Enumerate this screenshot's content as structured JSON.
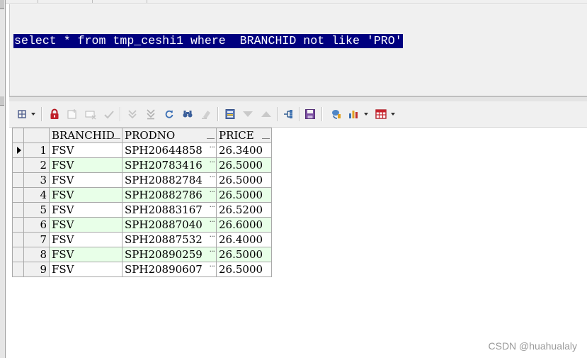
{
  "editor": {
    "sql": "select * from tmp_ceshi1 where  BRANCHID not like 'PRO'"
  },
  "toolbar": {
    "icons": [
      "select-grid-icon",
      "lock-icon",
      "add-row-icon",
      "delete-row-icon",
      "post-changes-icon",
      "first-record-icon",
      "last-record-icon",
      "refresh-icon",
      "find-icon",
      "clear-icon",
      "query-by-example-icon",
      "sort-descending-icon",
      "sort-ascending-icon",
      "export-tree-icon",
      "save-icon",
      "link-icon",
      "chart-icon",
      "table-icon"
    ]
  },
  "grid": {
    "columns": [
      "BRANCHID",
      "PRODNO",
      "PRICE"
    ],
    "rows": [
      {
        "num": "1",
        "branchid": "FSV",
        "prodno": "SPH20644858",
        "price": "26.3400"
      },
      {
        "num": "2",
        "branchid": "FSV",
        "prodno": "SPH20783416",
        "price": "26.5000"
      },
      {
        "num": "3",
        "branchid": "FSV",
        "prodno": "SPH20882784",
        "price": "26.5000"
      },
      {
        "num": "4",
        "branchid": "FSV",
        "prodno": "SPH20882786",
        "price": "26.5000"
      },
      {
        "num": "5",
        "branchid": "FSV",
        "prodno": "SPH20883167",
        "price": "26.5200"
      },
      {
        "num": "6",
        "branchid": "FSV",
        "prodno": "SPH20887040",
        "price": "26.6000"
      },
      {
        "num": "7",
        "branchid": "FSV",
        "prodno": "SPH20887532",
        "price": "26.4000"
      },
      {
        "num": "8",
        "branchid": "FSV",
        "prodno": "SPH20890259",
        "price": "26.5000"
      },
      {
        "num": "9",
        "branchid": "FSV",
        "prodno": "SPH20890607",
        "price": "26.5000"
      }
    ],
    "dots": "···"
  },
  "watermark": "CSDN @huahualaly",
  "colors": {
    "selection_bg": "#00007f",
    "alt_row_bg": "#e8ffe8",
    "lock_red": "#c0202a"
  }
}
